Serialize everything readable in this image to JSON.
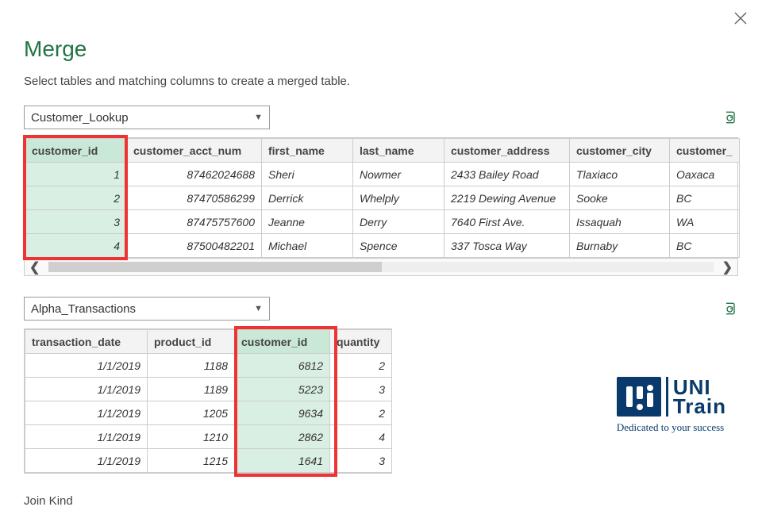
{
  "window": {
    "title": "Merge",
    "subtitle": "Select tables and matching columns to create a merged table.",
    "join_kind_label": "Join Kind"
  },
  "table1": {
    "dropdown": "Customer_Lookup",
    "columns": [
      "customer_id",
      "customer_acct_num",
      "first_name",
      "last_name",
      "customer_address",
      "customer_city",
      "customer_"
    ],
    "rows": [
      {
        "customer_id": "1",
        "customer_acct_num": "87462024688",
        "first_name": "Sheri",
        "last_name": "Nowmer",
        "customer_address": "2433 Bailey Road",
        "customer_city": "Tlaxiaco",
        "customer_state": "Oaxaca"
      },
      {
        "customer_id": "2",
        "customer_acct_num": "87470586299",
        "first_name": "Derrick",
        "last_name": "Whelply",
        "customer_address": "2219 Dewing Avenue",
        "customer_city": "Sooke",
        "customer_state": "BC"
      },
      {
        "customer_id": "3",
        "customer_acct_num": "87475757600",
        "first_name": "Jeanne",
        "last_name": "Derry",
        "customer_address": "7640 First Ave.",
        "customer_city": "Issaquah",
        "customer_state": "WA"
      },
      {
        "customer_id": "4",
        "customer_acct_num": "87500482201",
        "first_name": "Michael",
        "last_name": "Spence",
        "customer_address": "337 Tosca Way",
        "customer_city": "Burnaby",
        "customer_state": "BC"
      }
    ],
    "selected_column": "customer_id"
  },
  "table2": {
    "dropdown": "Alpha_Transactions",
    "columns": [
      "transaction_date",
      "product_id",
      "customer_id",
      "quantity"
    ],
    "rows": [
      {
        "transaction_date": "1/1/2019",
        "product_id": "1188",
        "customer_id": "6812",
        "quantity": "2"
      },
      {
        "transaction_date": "1/1/2019",
        "product_id": "1189",
        "customer_id": "5223",
        "quantity": "3"
      },
      {
        "transaction_date": "1/1/2019",
        "product_id": "1205",
        "customer_id": "9634",
        "quantity": "2"
      },
      {
        "transaction_date": "1/1/2019",
        "product_id": "1210",
        "customer_id": "2862",
        "quantity": "4"
      },
      {
        "transaction_date": "1/1/2019",
        "product_id": "1215",
        "customer_id": "1641",
        "quantity": "3"
      }
    ],
    "selected_column": "customer_id"
  },
  "branding": {
    "name1": "UNI",
    "name2": "Train",
    "tagline": "Dedicated to your success"
  }
}
